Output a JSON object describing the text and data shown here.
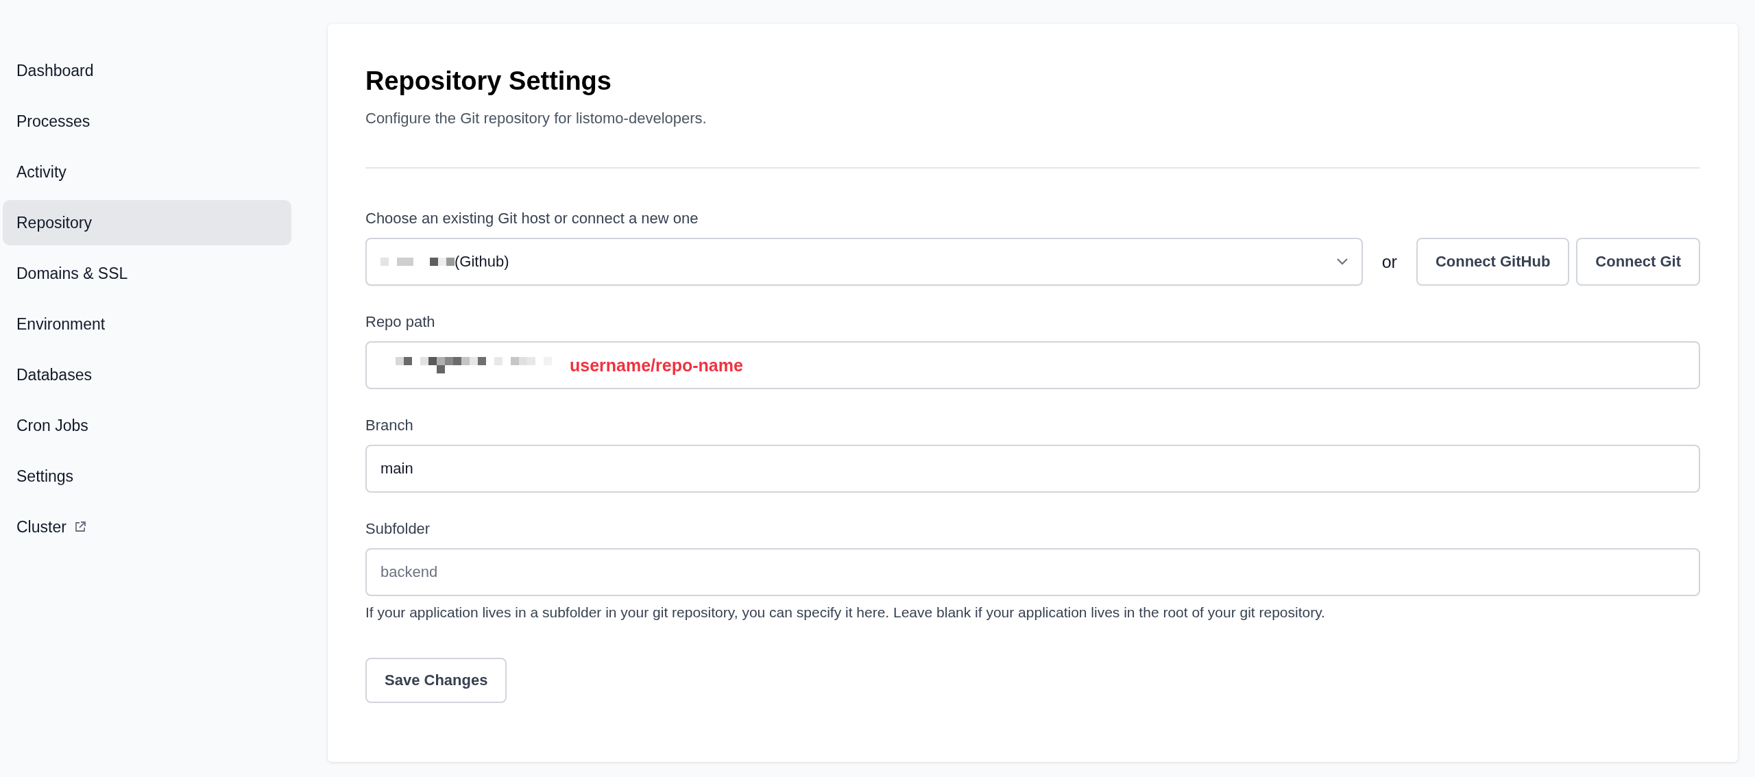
{
  "sidebar": {
    "items": [
      {
        "label": "Dashboard",
        "selected": false,
        "external": false
      },
      {
        "label": "Processes",
        "selected": false,
        "external": false
      },
      {
        "label": "Activity",
        "selected": false,
        "external": false
      },
      {
        "label": "Repository",
        "selected": true,
        "external": false
      },
      {
        "label": "Domains & SSL",
        "selected": false,
        "external": false
      },
      {
        "label": "Environment",
        "selected": false,
        "external": false
      },
      {
        "label": "Databases",
        "selected": false,
        "external": false
      },
      {
        "label": "Cron Jobs",
        "selected": false,
        "external": false
      },
      {
        "label": "Settings",
        "selected": false,
        "external": false
      },
      {
        "label": "Cluster",
        "selected": false,
        "external": true
      }
    ]
  },
  "page": {
    "title": "Repository Settings",
    "subtitle": "Configure the Git repository for listomo-developers."
  },
  "git_host": {
    "label": "Choose an existing Git host or connect a new one",
    "redacted": true,
    "value": "(Github)",
    "separator": "or",
    "buttons": [
      "Connect GitHub",
      "Connect Git"
    ]
  },
  "fields": [
    {
      "label": "Repo path",
      "redacted": true,
      "annotation": "username/repo-name"
    },
    {
      "label": "Branch",
      "redacted": false,
      "value": "main"
    },
    {
      "label": "Subfolder",
      "redacted": false,
      "placeholder": "backend",
      "help": "If your application lives in a subfolder in your git repository, you can specify it here. Leave blank if your application lives in the root of your git repository."
    }
  ],
  "save_button": "Save Changes"
}
